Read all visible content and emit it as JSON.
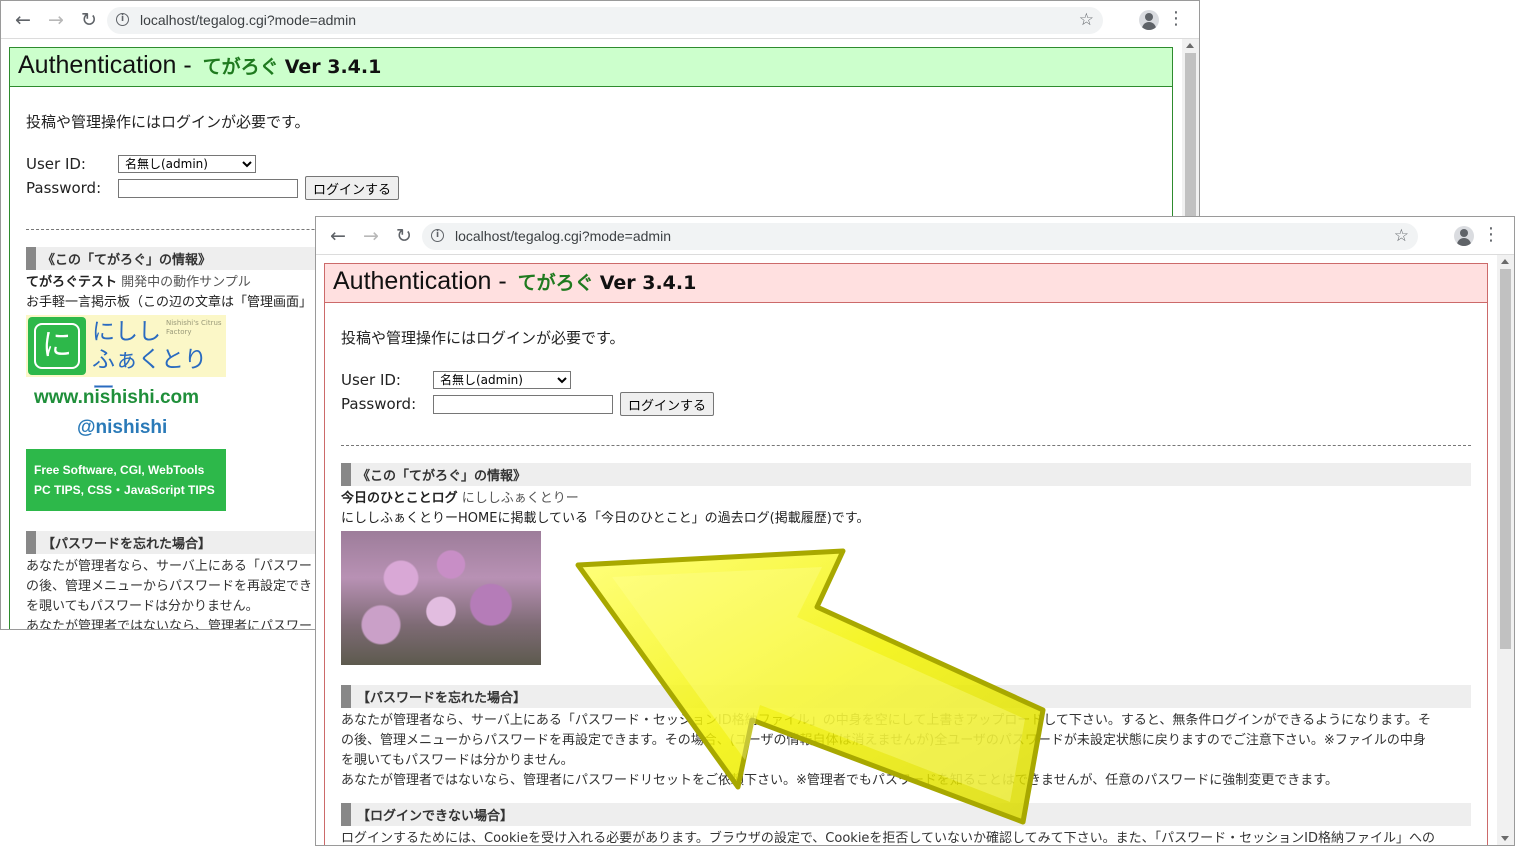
{
  "browser": {
    "url": "localhost/tegalog.cgi?mode=admin"
  },
  "page": {
    "title_main": "Authentication - ",
    "title_app": "てがろぐ",
    "title_version": "Ver 3.4.1",
    "lead": "投稿や管理操作にはログインが必要です。",
    "user_id_label": "User ID:",
    "user_id_value": "名無し(admin)",
    "password_label": "Password:",
    "login_button": "ログインする"
  },
  "back_window": {
    "info_heading": "《この「てがろぐ」の情報》",
    "info_name": "てがろぐテスト",
    "info_sub": "開発中の動作サンプル",
    "info_desc": "お手軽一言掲示板（この辺の文章は「管理画面」",
    "logo_name_line1": "にしし",
    "logo_name_line2": "ふぁくとりー",
    "logo_sub": "Nishishi's Citrus Factory",
    "logo_url": "www.nishishi.com",
    "logo_handle": "@nishishi",
    "banner_line1": "Free Software, CGI, WebTools",
    "banner_line2": "PC TIPS, CSS・JavaScript TIPS",
    "pw_heading": "【パスワードを忘れた場合】",
    "pw_line1": "あなたが管理者なら、サーバ上にある「パスワー",
    "pw_line2": "の後、管理メニューからパスワードを再設定でき",
    "pw_line3": "を覗いてもパスワードは分かりません。",
    "pw_line4": "あなたが管理者ではないなら、管理者にパスワー"
  },
  "front_window": {
    "info_heading": "《この「てがろぐ」の情報》",
    "info_name": "今日のひとことログ",
    "info_sub": "にししふぁくとりー",
    "info_desc": "にししふぁくとりーHOMEに掲載している「今日のひとこと」の過去ログ(掲載履歴)です。",
    "pw_heading": "【パスワードを忘れた場合】",
    "pw_line1": "あなたが管理者なら、サーバ上にある「パスワード・セッションID格納ファイル」の中身を空にして上書きアップロードして下さい。すると、無条件ログインができるようになります。そ",
    "pw_line2": "の後、管理メニューからパスワードを再設定できます。その場合、(ユーザの情報自体は消えませんが)全ユーザのパスワードが未設定状態に戻りますのでご注意下さい。※ファイルの中身",
    "pw_line3": "を覗いてもパスワードは分かりません。",
    "pw_line4": "あなたが管理者ではないなら、管理者にパスワードリセットをご依頼下さい。※管理者でもパスワードを知ることはできませんが、任意のパスワードに強制変更できます。",
    "cannot_heading": "【ログインできない場合】",
    "cannot_line1": "ログインするためには、Cookieを受け入れる必要があります。ブラウザの設定で、Cookieを拒否していないか確認してみて下さい。また、「パスワード・セッションID格納ファイル」への"
  },
  "icons": {
    "back": "arrow-left-icon",
    "forward": "arrow-right-icon",
    "reload": "reload-icon",
    "info": "info-icon",
    "star": "star-icon",
    "profile": "profile-icon",
    "menu": "kebab-menu-icon"
  },
  "colors": {
    "back_title_bg": "#ccffcc",
    "front_title_bg": "#ffe0e0",
    "app_name": "#1f7a1f",
    "arrow": "#f2f200"
  }
}
